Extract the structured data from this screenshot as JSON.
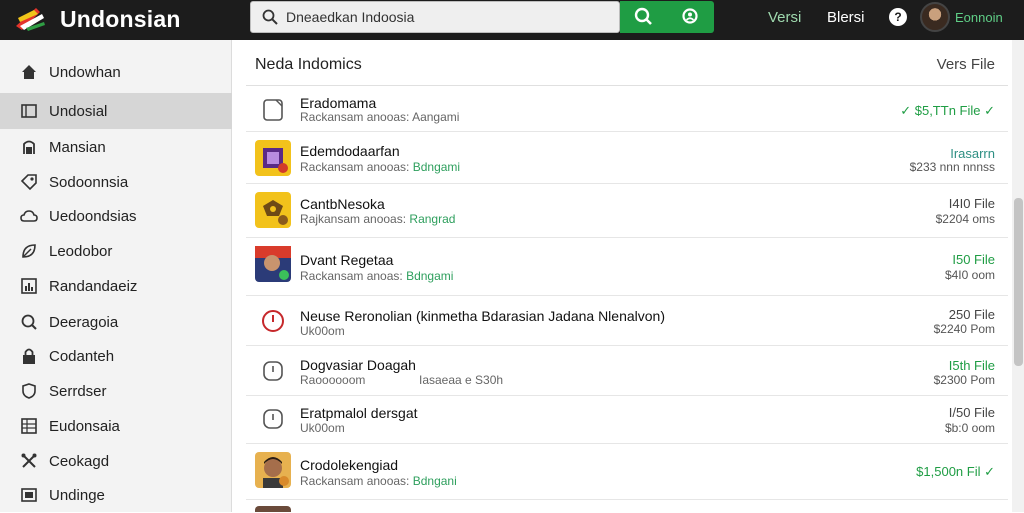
{
  "app": {
    "title": "Undonsian",
    "search": {
      "value": "Dneaedkan Indoosia",
      "placeholder": ""
    },
    "nav": {
      "versi": "Versi",
      "blersi": "Blersi",
      "help": "?"
    },
    "user": {
      "name": "Eonnoin"
    }
  },
  "sidebar": {
    "items": [
      {
        "label": "Undowhan",
        "icon": "home-icon",
        "active": false
      },
      {
        "label": "Undosial",
        "icon": "window-icon",
        "active": true
      },
      {
        "label": "Mansian",
        "icon": "person-icon",
        "active": false
      },
      {
        "label": "Sodoonnsia",
        "icon": "tag-icon",
        "active": false
      },
      {
        "label": "Uedoondsias",
        "icon": "cloud-icon",
        "active": false
      },
      {
        "label": "Leodobor",
        "icon": "leaf-icon",
        "active": false
      },
      {
        "label": "Randandaeiz",
        "icon": "chart-icon",
        "active": false
      },
      {
        "label": "Deeragoia",
        "icon": "search-icon",
        "active": false
      },
      {
        "label": "Codanteh",
        "icon": "lock-icon",
        "active": false
      },
      {
        "label": "Serrdser",
        "icon": "shield-icon",
        "active": false
      },
      {
        "label": "Eudonsaia",
        "icon": "grid-icon",
        "active": false
      },
      {
        "label": "Ceokagd",
        "icon": "tools-icon",
        "active": false
      },
      {
        "label": "Undinge",
        "icon": "media-icon",
        "active": false
      }
    ]
  },
  "main": {
    "header": {
      "title": "Neda Indomics",
      "right": "Vers File"
    },
    "rows": [
      {
        "title": "Eradomama",
        "sub": "Rackansam anooas: Aangami",
        "tag": "",
        "line1": "✓ $5,TTn File ✓",
        "line2": "",
        "icon": "file-icon",
        "green1": true
      },
      {
        "title": "Edemdodaarfan",
        "sub": "Rackansam anooas: ",
        "tag": "Bdngami",
        "line1": "Irasarrn",
        "line2": "$233 nnn nnnss",
        "icon": "purple-app-icon",
        "green1": false,
        "teal1": true
      },
      {
        "title": "CantbNesoka",
        "sub": "Rajkansam anooas: ",
        "tag": "Rangrad",
        "line1": "I4I0 File",
        "line2": "$2204 oms",
        "icon": "yellow-app-icon",
        "green1": false
      },
      {
        "title": "Dvant Regetaa",
        "sub": "Rackansam anoas: ",
        "tag": "Bdngami",
        "line1": "I50 File",
        "line2": "$4I0 oom",
        "icon": "portrait-app-icon",
        "green1": true
      },
      {
        "title": "Neuse Reronolian (kinmetha Bdarasian Jadana Nlenalvon)",
        "sub": "Uk00om",
        "tag": "",
        "line1": "250 File",
        "line2": "$2240 Pom",
        "icon": "red-circle-icon",
        "green1": false
      },
      {
        "title": "Dogvasiar Doagah",
        "sub": "Raoooooom",
        "tag": "",
        "extra": "Iasaeaa e S30h",
        "line1": "I5th File",
        "line2": "$2300 Pom",
        "icon": "clock-icon",
        "green1": true
      },
      {
        "title": "Eratpmalol dersgat",
        "sub": "Uk00om",
        "tag": "",
        "line1": "I/50 File",
        "line2": "$b:0 oom",
        "icon": "clock-icon",
        "green1": false
      },
      {
        "title": "Crodolekengiad",
        "sub": "Rackansam anooas: ",
        "tag": "Bdngani",
        "line1": "$1,500n Fil ✓",
        "line2": "",
        "icon": "face-app-icon",
        "green1": true
      }
    ]
  }
}
